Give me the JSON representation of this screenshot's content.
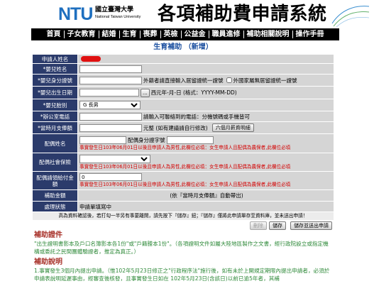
{
  "theme": {
    "nav_bg": "#000000",
    "label_bg": "#2b3b6b",
    "cell_bg": "#d5d5d5",
    "title_blue": "#1b4fa0",
    "note_red": "#d40000",
    "section_red": "#a8322a",
    "body_green": "#2f8a3a",
    "logo_blue": "#1e6fbf"
  },
  "header": {
    "logo_text": "NTU",
    "univ_name_zh": "國立臺灣大學",
    "univ_name_en": "National Taiwan University",
    "system_title": "各項補助費申請系統"
  },
  "nav": {
    "items": [
      "首頁",
      "子女教育",
      "結婚",
      "生育",
      "喪葬",
      "英檢",
      "公益金",
      "職員進修",
      "補助相關說明",
      "操作手冊"
    ]
  },
  "page_title": "生育補助 （新增）",
  "form": {
    "applicant_name": {
      "label": "申請人姓名"
    },
    "baby_name": {
      "label": "*嬰兒姓名",
      "value": ""
    },
    "baby_id": {
      "label": "*嬰兒身分證號",
      "value": "",
      "hint": "外籍者請直接輸入居留證統一證號",
      "checkbox_label": "外國家屬無居留證統一證號"
    },
    "baby_birth": {
      "label": "*嬰兒出生日期",
      "value": "",
      "picker_label": "...",
      "hint": "西元年-月-日 (格式：YYYY-MM-DD)"
    },
    "baby_order": {
      "label": "*嬰兒胎別",
      "selected": "G 長男"
    },
    "office_phone": {
      "label": "*辦公室電話",
      "value": "",
      "hint": "請輸入可聯絡到的電話：分機號碼或手機皆可"
    },
    "monthly_salary": {
      "label": "*當時月支俸額",
      "value": "",
      "unit": "元整 (如有建議請自行修改)",
      "button": "六個月薪資明細"
    },
    "spouse_name": {
      "label": "配偶姓名",
      "value": "",
      "id_label": "配偶身分證字號",
      "id_value": "",
      "note": "事實發生日103年06月01日以後且申請人為男性,此欄位必填：女生申請人且配偶為農保者,此欄位必填"
    },
    "spouse_insurance": {
      "label": "配偶社會保險",
      "selected": "",
      "note": "事實發生日103年06月01日以後且申請人為男性,此欄位必填：女生申請人且配偶為農保者,此欄位必填"
    },
    "spouse_benefit": {
      "label": "配偶請領給付金額",
      "value": "0",
      "note": "事實發生日103年06月01日以後且申請人為男性,此欄位必填：女生申請人且配偶為農保者,此欄位必填"
    },
    "subsidy_amount": {
      "label": "補助金額",
      "text": "(依『當時月支俸額』自動帶出)"
    },
    "status": {
      "label": "處理狀態",
      "text": "申請單填寫中"
    }
  },
  "save_note": "高為資料確認後，若打勾一半另有事要離開，請先按下『儲存』鈕；『儲存』僅將此申請單存至資料庫，並未送出申請！",
  "actions": {
    "delete": "刪除",
    "save": "儲存",
    "save_submit": "儲存並送出申請"
  },
  "documents": {
    "heading": "補助證件",
    "text": "\"出生證明書影本及戶口名簿影本各1份\"或\"戶籍謄本1份\"。（各項證明文件如屬大陸地區製作之文書，經行政院設立或指定機構或委託之民間團體驗證者，推定為真正。）"
  },
  "instructions": {
    "heading": "補助說明",
    "text": "1.事實發生3個月內提出申請。（惟102年5月23日修正之\"行政程序法\"施行後，如有未於上開規定期限內提出申請者，必須於申請表說明延遲事由，經審查後核發，且事實發生日如在 102年5月23日(含該日)以前已逾5年者，其補"
  }
}
